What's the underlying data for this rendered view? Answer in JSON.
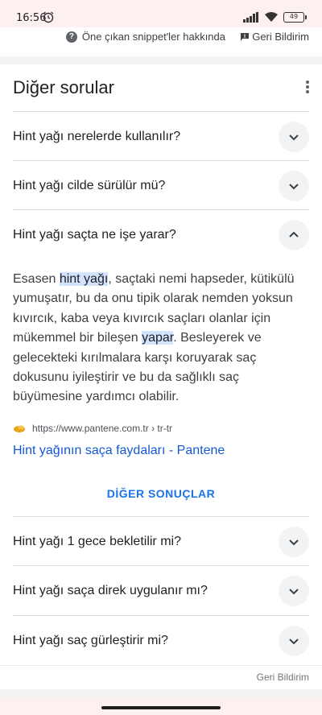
{
  "status": {
    "time": "16:56",
    "battery": "49"
  },
  "snippet_bar": {
    "about_label": "Öne çıkan snippet'ler hakkında",
    "feedback_label": "Geri Bildirim"
  },
  "card": {
    "title": "Diğer sorular",
    "questions_top": [
      {
        "text": "Hint yağı nerelerde kullanılır?"
      },
      {
        "text": "Hint yağı cilde sürülür mü?"
      },
      {
        "text": "Hint yağı saçta ne işe yarar?"
      }
    ],
    "answer": {
      "p1": "Esasen ",
      "h1": "hint yağı",
      "p2": ", saçtaki nemi hapseder, kütikülü yumuşatır, bu da onu tipik olarak nemden yoksun kıvırcık, kaba veya kıvırcık saçları olanlar için mükemmel bir bileşen ",
      "h2": "yapar",
      "p3": ". Besleyerek ve gelecekteki kırılmalara karşı koruyarak saç dokusunu iyileştirir ve bu da sağlıklı saç büyümesine yardımcı olabilir."
    },
    "source": {
      "url": "https://www.pantene.com.tr › tr-tr",
      "link_title": "Hint yağının saça faydaları - Pantene"
    },
    "more_results": "DİĞER SONUÇLAR",
    "questions_bottom": [
      {
        "text": "Hint yağı 1 gece bekletilir mi?"
      },
      {
        "text": "Hint yağı saça direk uygulanır mı?"
      },
      {
        "text": "Hint yağı saç gürleştirir mi?"
      }
    ],
    "feedback": "Geri Bildirim"
  },
  "colors": {
    "accent": "#1a73e8",
    "link": "#1558d6",
    "highlight": "#d3e3fd"
  },
  "icons": [
    "alarm-icon",
    "signal-icon",
    "wifi-icon",
    "battery-icon",
    "help-icon",
    "feedback-icon",
    "more-vert-icon",
    "chevron-down-icon",
    "chevron-up-icon",
    "favicon"
  ]
}
